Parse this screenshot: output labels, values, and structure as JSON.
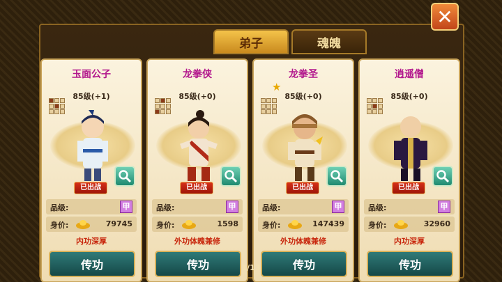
{
  "tabs": [
    {
      "label": "弟子",
      "active": true
    },
    {
      "label": "魂魄",
      "active": false
    }
  ],
  "close_icon": "close-x-icon",
  "labels": {
    "grade": "品级:",
    "price": "身价:",
    "deployed": "已出战",
    "transfer": "传功"
  },
  "cards": [
    {
      "name": "玉面公子",
      "level": "85级(+1)",
      "grade": "甲",
      "price": "79745",
      "skill": "内功深厚",
      "starred": false
    },
    {
      "name": "龙拳侠",
      "level": "85级(+0)",
      "grade": "甲",
      "price": "1598",
      "skill": "外功体魄兼修",
      "starred": false
    },
    {
      "name": "龙拳圣",
      "level": "85级(+0)",
      "grade": "甲",
      "price": "147439",
      "skill": "外功体魄兼修",
      "starred": true
    },
    {
      "name": "逍遥僧",
      "level": "85级(+0)",
      "grade": "甲",
      "price": "32960",
      "skill": "内功深厚",
      "starred": false
    }
  ],
  "pager": "1/13",
  "colors": {
    "name": "#b2178d",
    "skill": "#c8280e",
    "transfer_button": "#2f7a78",
    "active_tab": "#f4c34a"
  }
}
